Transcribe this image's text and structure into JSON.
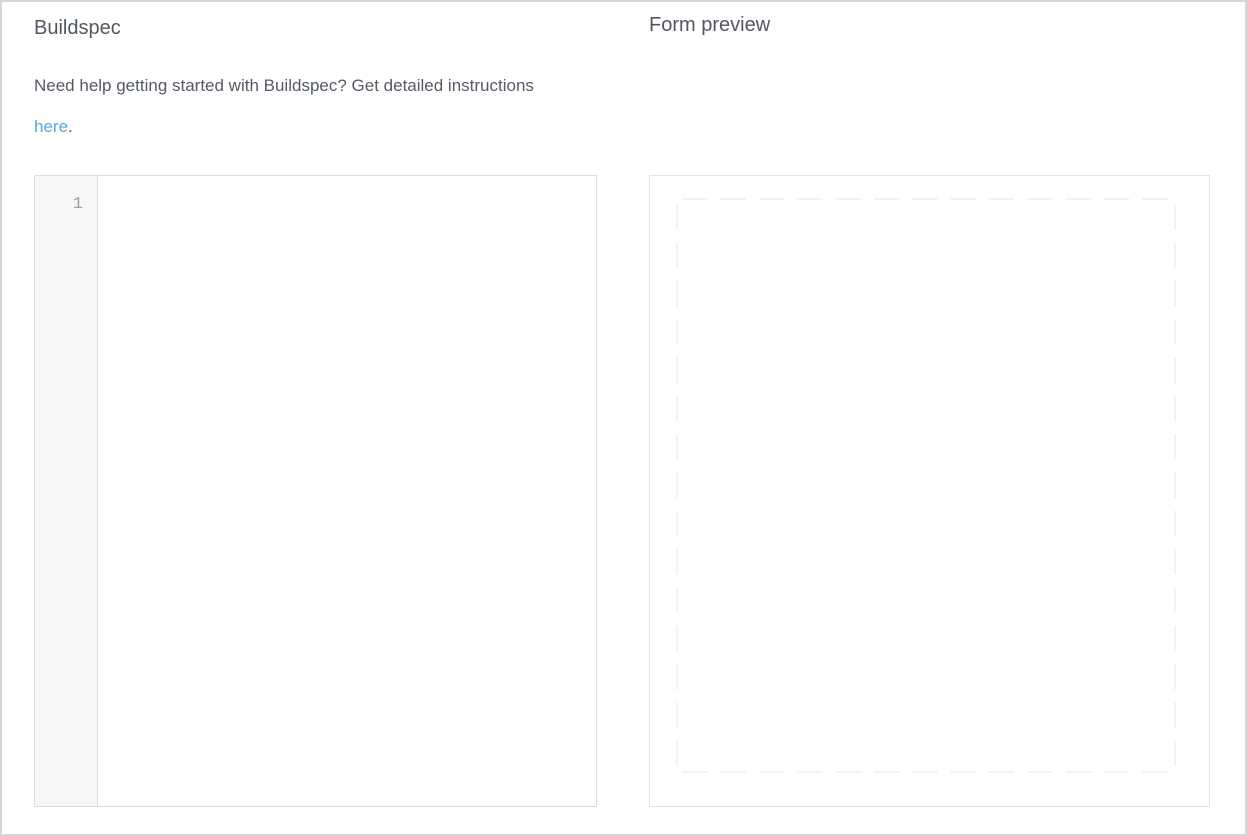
{
  "buildspec": {
    "heading": "Buildspec",
    "help_text_before": "Need help getting started with Buildspec? Get detailed instructions ",
    "help_link_label": "here",
    "help_text_after": ".",
    "editor": {
      "line_numbers": [
        "1"
      ],
      "code_value": "",
      "placeholder": ""
    }
  },
  "form_preview": {
    "heading": "Form preview",
    "canvas_content": ""
  },
  "colors": {
    "heading_text": "#52585f",
    "body_text": "#545b64",
    "link": "#59a7da",
    "gutter_background": "#f7f7f7",
    "gutter_line_number": "#9aa0a6",
    "box_border": "#dcdcdc",
    "preview_border": "#e2e2e2",
    "preview_dot": "#e4e6e8",
    "page_border": "#d6d6d6",
    "page_background": "#ffffff"
  }
}
